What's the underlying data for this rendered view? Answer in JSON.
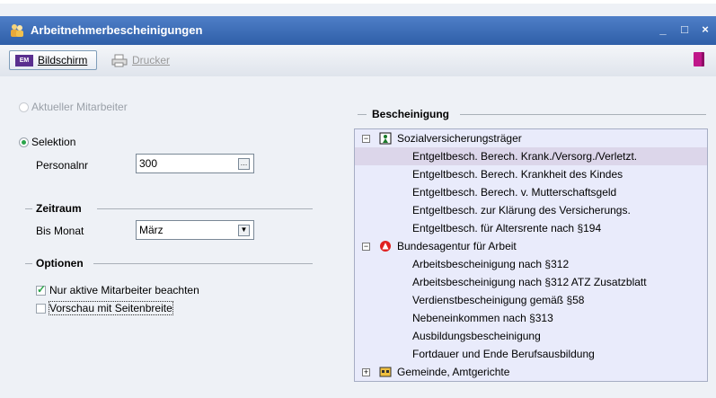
{
  "window": {
    "title": "Arbeitnehmerbescheinigungen",
    "minimize": "_",
    "maximize": "□",
    "close": "×"
  },
  "toolbar": {
    "screen_label": "Bildschirm",
    "screen_icon_text": "EM",
    "print_label": "Drucker"
  },
  "selection": {
    "current_employee_label": "Aktueller Mitarbeiter",
    "selection_label": "Selektion",
    "personnel_label": "Personalnr",
    "personnel_value": "300"
  },
  "period": {
    "title": "Zeitraum",
    "month_label": "Bis Monat",
    "month_value": "März"
  },
  "options": {
    "title": "Optionen",
    "active_only_label": "Nur aktive Mitarbeiter beachten",
    "preview_label": "Vorschau mit Seitenbreite"
  },
  "certificates": {
    "title": "Bescheinigung",
    "groups": [
      {
        "label": "Sozialversicherungsträger",
        "items": [
          "Entgeltbesch. Berech. Krank./Versorg./Verletzt.",
          "Entgeltbesch. Berech. Krankheit des Kindes",
          "Entgeltbesch. Berech. v. Mutterschaftsgeld",
          "Entgeltbesch. zur Klärung des Versicherungs.",
          "Entgeltbesch. für Altersrente nach §194"
        ]
      },
      {
        "label": "Bundesagentur für Arbeit",
        "items": [
          "Arbeitsbescheinigung nach §312",
          "Arbeitsbescheinigung nach §312 ATZ Zusatzblatt",
          "Verdienstbescheinigung gemäß §58",
          "Nebeneinkommen nach §313",
          "Ausbildungsbescheinigung",
          "Fortdauer und Ende Berufsausbildung"
        ]
      },
      {
        "label": "Gemeinde, Amtgerichte",
        "items": []
      }
    ]
  },
  "colors": {
    "titlebar": "#3a6ab5",
    "tree_bg": "#e9ebfb",
    "selected_row": "#dcd6ea",
    "accent_green": "#2aa44a"
  }
}
